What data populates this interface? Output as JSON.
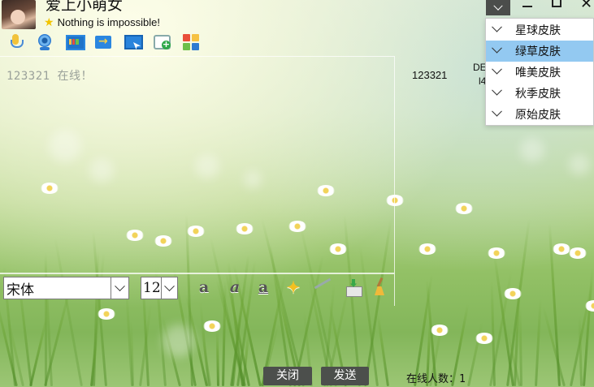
{
  "profile": {
    "nickname": "爱上小萌女",
    "signature": "Nothing is impossible!"
  },
  "toolbar": {
    "icons": [
      "microphone-icon",
      "webcam-icon",
      "screen-share-icon",
      "file-transfer-icon",
      "remote-desktop-icon",
      "new-message-icon",
      "apps-icon"
    ]
  },
  "chat": {
    "message": "123321 在线！"
  },
  "format": {
    "font": "宋体",
    "size": "12",
    "bold_glyph": "a",
    "italic_glyph": "a",
    "underline_glyph": "a",
    "emoji_glyph": "✦"
  },
  "buttons": {
    "close": "关闭",
    "send": "发送"
  },
  "status": {
    "online_count": "在线人数：1"
  },
  "right_panel": {
    "user": "123321",
    "partial_1": "DE",
    "partial_2": "l4"
  },
  "skin_menu": {
    "items": [
      "星球皮肤",
      "绿草皮肤",
      "唯美皮肤",
      "秋季皮肤",
      "原始皮肤"
    ],
    "selected": "绿草皮肤"
  },
  "colors": {
    "menu_highlight": "#93c9f1",
    "button_bg": "#4c4f4c",
    "star": "#f2c400"
  }
}
